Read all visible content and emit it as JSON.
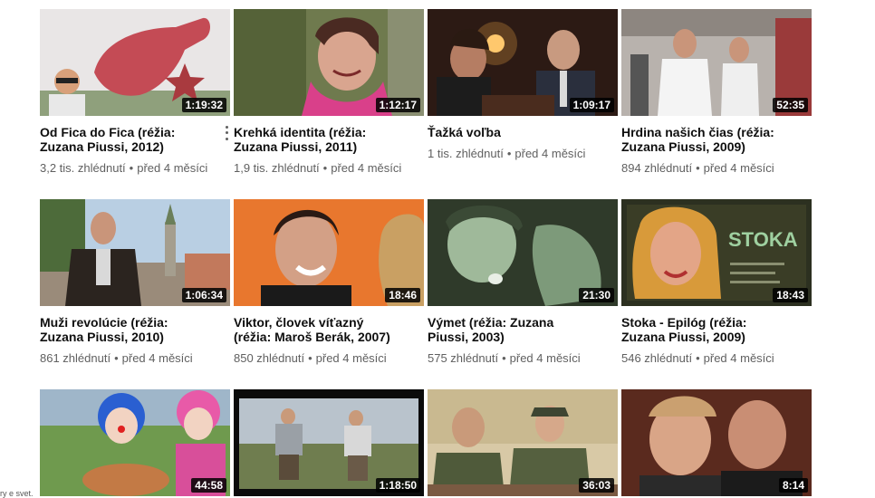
{
  "videos": [
    {
      "title": "Od Fica do Fica (réžia: Zuzana Piussi, 2012)",
      "views": "3,2 tis. zhlédnutí",
      "age": "před 4 měsíci",
      "duration": "1:19:32",
      "has_menu": true
    },
    {
      "title": "Krehká identita (réžia: Zuzana Piussi, 2011)",
      "views": "1,9 tis. zhlédnutí",
      "age": "před 4 měsíci",
      "duration": "1:12:17"
    },
    {
      "title": "Ťažká voľba",
      "views": "1 tis. zhlédnutí",
      "age": "před 4 měsíci",
      "duration": "1:09:17"
    },
    {
      "title": "Hrdina našich čias (réžia: Zuzana Piussi, 2009)",
      "views": "894 zhlédnutí",
      "age": "před 4 měsíci",
      "duration": "52:35"
    },
    {
      "title": "Muži revolúcie (réžia: Zuzana Piussi, 2010)",
      "views": "861 zhlédnutí",
      "age": "před 4 měsíci",
      "duration": "1:06:34"
    },
    {
      "title": "Viktor, človek víťazný (réžia: Maroš Berák, 2007)",
      "views": "850 zhlédnutí",
      "age": "před 4 měsíci",
      "duration": "18:46"
    },
    {
      "title": "Výmet (réžia: Zuzana Piussi, 2003)",
      "views": "575 zhlédnutí",
      "age": "před 4 měsíci",
      "duration": "21:30"
    },
    {
      "title": "Stoka - Epilóg (réžia: Zuzana Piussi, 2009)",
      "views": "546 zhlédnutí",
      "age": "před 4 měsíci",
      "duration": "18:43"
    },
    {
      "duration": "44:58"
    },
    {
      "duration": "1:18:50"
    },
    {
      "duration": "36:03"
    },
    {
      "duration": "8:14"
    }
  ],
  "thumb_text": {
    "stoka": "STOKA"
  },
  "meta_separator": "•",
  "corner_text": "ry e svet."
}
